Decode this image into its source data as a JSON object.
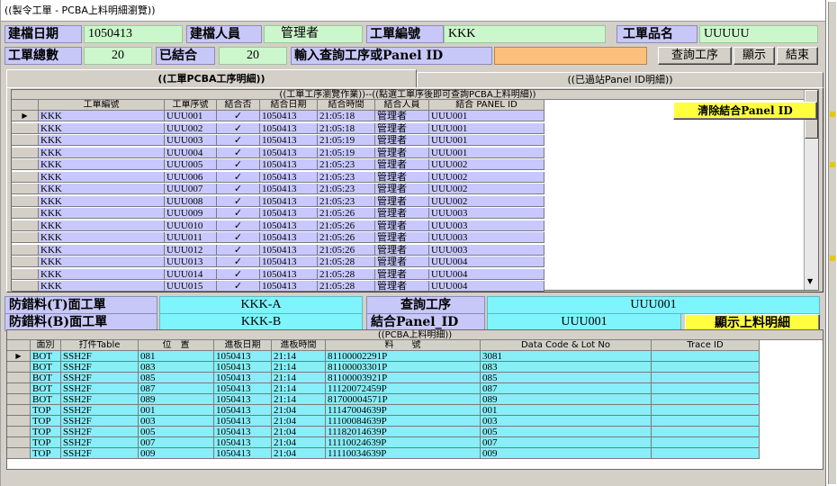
{
  "window": {
    "title": "((製令工單 - PCBA上料明細瀏覽))"
  },
  "header": {
    "create_date_label": "建檔日期",
    "create_date_value": "1050413",
    "creator_label": "建檔人員",
    "creator_value": "管理者",
    "order_no_label": "工單編號",
    "order_no_value": "KKK",
    "product_name_label": "工單品名",
    "product_name_value": "UUUUU",
    "total_label": "工單總數",
    "total_value": "20",
    "combined_label": "已結合",
    "combined_value": "20",
    "query_label": "輸入查詢工序或Panel ID",
    "query_value": "",
    "btn_query": "查詢工序",
    "btn_show": "顯示",
    "btn_end": "結束"
  },
  "tabs": [
    {
      "label": "((工單PCBA工序明細))"
    },
    {
      "label": "((已過站Panel ID明細))"
    }
  ],
  "process_grid": {
    "caption": "((工單工序瀏覽作業))--((點選工單序後即可查詢PCBA上料明細))",
    "columns": [
      "工單編號",
      "工單序號",
      "結合否",
      "結合日期",
      "結合時間",
      "結合人員",
      "結合 PANEL ID"
    ],
    "rows": [
      [
        "KKK",
        "UUU001",
        "✓",
        "1050413",
        "21:05:18",
        "管理者",
        "UUU001"
      ],
      [
        "KKK",
        "UUU002",
        "✓",
        "1050413",
        "21:05:18",
        "管理者",
        "UUU001"
      ],
      [
        "KKK",
        "UUU003",
        "✓",
        "1050413",
        "21:05:19",
        "管理者",
        "UUU001"
      ],
      [
        "KKK",
        "UUU004",
        "✓",
        "1050413",
        "21:05:19",
        "管理者",
        "UUU001"
      ],
      [
        "KKK",
        "UUU005",
        "✓",
        "1050413",
        "21:05:23",
        "管理者",
        "UUU002"
      ],
      [
        "KKK",
        "UUU006",
        "✓",
        "1050413",
        "21:05:23",
        "管理者",
        "UUU002"
      ],
      [
        "KKK",
        "UUU007",
        "✓",
        "1050413",
        "21:05:23",
        "管理者",
        "UUU002"
      ],
      [
        "KKK",
        "UUU008",
        "✓",
        "1050413",
        "21:05:23",
        "管理者",
        "UUU002"
      ],
      [
        "KKK",
        "UUU009",
        "✓",
        "1050413",
        "21:05:26",
        "管理者",
        "UUU003"
      ],
      [
        "KKK",
        "UUU010",
        "✓",
        "1050413",
        "21:05:26",
        "管理者",
        "UUU003"
      ],
      [
        "KKK",
        "UUU011",
        "✓",
        "1050413",
        "21:05:26",
        "管理者",
        "UUU003"
      ],
      [
        "KKK",
        "UUU012",
        "✓",
        "1050413",
        "21:05:26",
        "管理者",
        "UUU003"
      ],
      [
        "KKK",
        "UUU013",
        "✓",
        "1050413",
        "21:05:28",
        "管理者",
        "UUU004"
      ],
      [
        "KKK",
        "UUU014",
        "✓",
        "1050413",
        "21:05:28",
        "管理者",
        "UUU004"
      ],
      [
        "KKK",
        "UUU015",
        "✓",
        "1050413",
        "21:05:28",
        "管理者",
        "UUU004"
      ]
    ],
    "clear_button": "清除結合Panel ID"
  },
  "info": {
    "t_side_label": "防錯料(T)面工單",
    "t_side_value": "KKK-A",
    "b_side_label": "防錯料(B)面工單",
    "b_side_value": "KKK-B",
    "query_proc_label": "查詢工序",
    "query_proc_value": "UUU001",
    "panel_label": "結合Panel_ID",
    "panel_value": "UUU001",
    "show_detail_button": "顯示上料明細"
  },
  "material_grid": {
    "caption": "((PCBA上料明細))",
    "columns": [
      "面別",
      "打件Table",
      "位　置",
      "進板日期",
      "進板時間",
      "料　　號",
      "Data Code & Lot No",
      "Trace ID"
    ],
    "rows": [
      [
        "BOT",
        "SSH2F",
        "081",
        "1050413",
        "21:14",
        "81100002291P",
        "3081",
        ""
      ],
      [
        "BOT",
        "SSH2F",
        "083",
        "1050413",
        "21:14",
        "81100003301P",
        "083",
        ""
      ],
      [
        "BOT",
        "SSH2F",
        "085",
        "1050413",
        "21:14",
        "81100003921P",
        "085",
        ""
      ],
      [
        "BOT",
        "SSH2F",
        "087",
        "1050413",
        "21:14",
        "11120072459P",
        "087",
        ""
      ],
      [
        "BOT",
        "SSH2F",
        "089",
        "1050413",
        "21:14",
        "81700004571P",
        "089",
        ""
      ],
      [
        "TOP",
        "SSH2F",
        "001",
        "1050413",
        "21:04",
        "11147004639P",
        "001",
        ""
      ],
      [
        "TOP",
        "SSH2F",
        "003",
        "1050413",
        "21:04",
        "11100084639P",
        "003",
        ""
      ],
      [
        "TOP",
        "SSH2F",
        "005",
        "1050413",
        "21:04",
        "11182014639P",
        "005",
        ""
      ],
      [
        "TOP",
        "SSH2F",
        "007",
        "1050413",
        "21:04",
        "11110024639P",
        "007",
        ""
      ],
      [
        "TOP",
        "SSH2F",
        "009",
        "1050413",
        "21:04",
        "11110034639P",
        "009",
        ""
      ]
    ]
  }
}
